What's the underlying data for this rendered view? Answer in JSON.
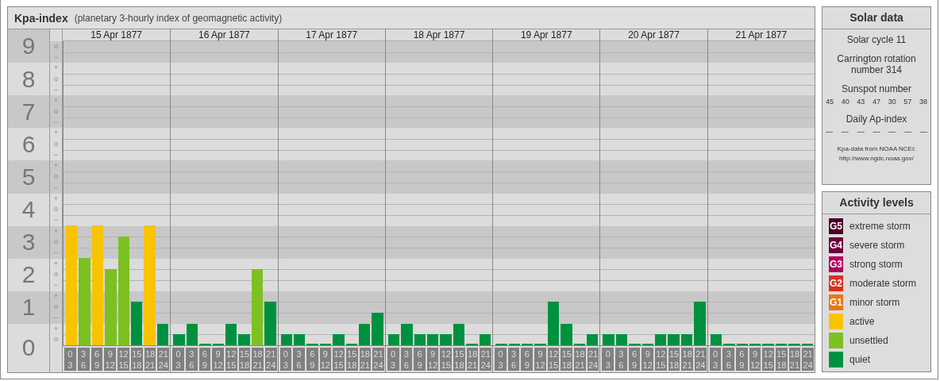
{
  "chart_panel": {
    "title": "Kpa-index",
    "subtitle": "(planetary 3-hourly index of geomagnetic activity)",
    "scale": [
      {
        "value": "9",
        "marks": [
          "o",
          "−"
        ]
      },
      {
        "value": "8",
        "marks": [
          "+",
          "o",
          "−"
        ]
      },
      {
        "value": "7",
        "marks": [
          "+",
          "o",
          "−"
        ]
      },
      {
        "value": "6",
        "marks": [
          "+",
          "o",
          "−"
        ]
      },
      {
        "value": "5",
        "marks": [
          "+",
          "o",
          "−"
        ]
      },
      {
        "value": "4",
        "marks": [
          "+",
          "o",
          "−"
        ]
      },
      {
        "value": "3",
        "marks": [
          "+",
          "o",
          "−"
        ]
      },
      {
        "value": "2",
        "marks": [
          "+",
          "o",
          "−"
        ]
      },
      {
        "value": "1",
        "marks": [
          "+",
          "o",
          "−"
        ]
      },
      {
        "value": "0",
        "marks": [
          "+",
          "o"
        ]
      }
    ],
    "days": [
      {
        "date": "15 Apr 1877",
        "slots": [
          {
            "from": "0",
            "to": "3",
            "level": 0.393,
            "color": "#f8c400"
          },
          {
            "from": "3",
            "to": "6",
            "level": 0.286,
            "color": "#7dc121"
          },
          {
            "from": "6",
            "to": "9",
            "level": 0.393,
            "color": "#f8c400"
          },
          {
            "from": "9",
            "to": "12",
            "level": 0.25,
            "color": "#7dc121"
          },
          {
            "from": "12",
            "to": "15",
            "level": 0.357,
            "color": "#7dc121"
          },
          {
            "from": "15",
            "to": "18",
            "level": 0.143,
            "color": "#009140"
          },
          {
            "from": "18",
            "to": "21",
            "level": 0.393,
            "color": "#f8c400"
          },
          {
            "from": "21",
            "to": "24",
            "level": 0.071,
            "color": "#009140"
          }
        ]
      },
      {
        "date": "16 Apr 1877",
        "slots": [
          {
            "from": "0",
            "to": "3",
            "level": 0.036,
            "color": "#009140"
          },
          {
            "from": "3",
            "to": "6",
            "level": 0.071,
            "color": "#009140"
          },
          {
            "from": "6",
            "to": "9",
            "level": 0,
            "color": "#009140"
          },
          {
            "from": "9",
            "to": "12",
            "level": 0,
            "color": "#009140"
          },
          {
            "from": "12",
            "to": "15",
            "level": 0.071,
            "color": "#009140"
          },
          {
            "from": "15",
            "to": "18",
            "level": 0.036,
            "color": "#009140"
          },
          {
            "from": "18",
            "to": "21",
            "level": 0.25,
            "color": "#7dc121"
          },
          {
            "from": "21",
            "to": "24",
            "level": 0.143,
            "color": "#009140"
          }
        ]
      },
      {
        "date": "17 Apr 1877",
        "slots": [
          {
            "from": "0",
            "to": "3",
            "level": 0.036,
            "color": "#009140"
          },
          {
            "from": "3",
            "to": "6",
            "level": 0.036,
            "color": "#009140"
          },
          {
            "from": "6",
            "to": "9",
            "level": 0,
            "color": "#009140"
          },
          {
            "from": "9",
            "to": "12",
            "level": 0,
            "color": "#009140"
          },
          {
            "from": "12",
            "to": "15",
            "level": 0.036,
            "color": "#009140"
          },
          {
            "from": "15",
            "to": "18",
            "level": 0,
            "color": "#009140"
          },
          {
            "from": "18",
            "to": "21",
            "level": 0.071,
            "color": "#009140"
          },
          {
            "from": "21",
            "to": "24",
            "level": 0.107,
            "color": "#009140"
          }
        ]
      },
      {
        "date": "18 Apr 1877",
        "slots": [
          {
            "from": "0",
            "to": "3",
            "level": 0.036,
            "color": "#009140"
          },
          {
            "from": "3",
            "to": "6",
            "level": 0.071,
            "color": "#009140"
          },
          {
            "from": "6",
            "to": "9",
            "level": 0.036,
            "color": "#009140"
          },
          {
            "from": "9",
            "to": "12",
            "level": 0.036,
            "color": "#009140"
          },
          {
            "from": "12",
            "to": "15",
            "level": 0.036,
            "color": "#009140"
          },
          {
            "from": "15",
            "to": "18",
            "level": 0.071,
            "color": "#009140"
          },
          {
            "from": "18",
            "to": "21",
            "level": 0,
            "color": "#009140"
          },
          {
            "from": "21",
            "to": "24",
            "level": 0.036,
            "color": "#009140"
          }
        ]
      },
      {
        "date": "19 Apr 1877",
        "slots": [
          {
            "from": "0",
            "to": "3",
            "level": 0,
            "color": "#009140"
          },
          {
            "from": "3",
            "to": "6",
            "level": 0,
            "color": "#009140"
          },
          {
            "from": "6",
            "to": "9",
            "level": 0,
            "color": "#009140"
          },
          {
            "from": "9",
            "to": "12",
            "level": 0,
            "color": "#009140"
          },
          {
            "from": "12",
            "to": "15",
            "level": 0.143,
            "color": "#009140"
          },
          {
            "from": "15",
            "to": "18",
            "level": 0.071,
            "color": "#009140"
          },
          {
            "from": "18",
            "to": "21",
            "level": 0,
            "color": "#009140"
          },
          {
            "from": "21",
            "to": "24",
            "level": 0.036,
            "color": "#009140"
          }
        ]
      },
      {
        "date": "20 Apr 1877",
        "slots": [
          {
            "from": "0",
            "to": "3",
            "level": 0.036,
            "color": "#009140"
          },
          {
            "from": "3",
            "to": "6",
            "level": 0.036,
            "color": "#009140"
          },
          {
            "from": "6",
            "to": "9",
            "level": 0,
            "color": "#009140"
          },
          {
            "from": "9",
            "to": "12",
            "level": 0,
            "color": "#009140"
          },
          {
            "from": "12",
            "to": "15",
            "level": 0.036,
            "color": "#009140"
          },
          {
            "from": "15",
            "to": "18",
            "level": 0.036,
            "color": "#009140"
          },
          {
            "from": "18",
            "to": "21",
            "level": 0.036,
            "color": "#009140"
          },
          {
            "from": "21",
            "to": "24",
            "level": 0.143,
            "color": "#009140"
          }
        ]
      },
      {
        "date": "21 Apr 1877",
        "slots": [
          {
            "from": "0",
            "to": "3",
            "level": 0.036,
            "color": "#009140"
          },
          {
            "from": "3",
            "to": "6",
            "level": 0,
            "color": "#009140"
          },
          {
            "from": "6",
            "to": "9",
            "level": 0,
            "color": "#009140"
          },
          {
            "from": "9",
            "to": "12",
            "level": 0,
            "color": "#009140"
          },
          {
            "from": "12",
            "to": "15",
            "level": 0,
            "color": "#009140"
          },
          {
            "from": "15",
            "to": "18",
            "level": 0,
            "color": "#009140"
          },
          {
            "from": "18",
            "to": "21",
            "level": 0,
            "color": "#009140"
          },
          {
            "from": "21",
            "to": "24",
            "level": 0,
            "color": "#009140"
          }
        ]
      }
    ]
  },
  "solar_data": {
    "title": "Solar data",
    "solar_cycle": "Solar cycle 11",
    "carrington_rotation": "Carrington rotation number 314",
    "sunspot_label": "Sunspot number",
    "sunspots": [
      "45",
      "40",
      "43",
      "47",
      "30",
      "57",
      "38"
    ],
    "ap_label": "Daily Ap-index",
    "ap_values": [
      "—",
      "—",
      "—",
      "—",
      "—",
      "—",
      "—"
    ],
    "source": "Kpa-data from NOAA NCEI:",
    "source_url": "http://www.ngdc.noaa.gov/"
  },
  "activity_levels": {
    "title": "Activity levels",
    "items": [
      {
        "badge": "G5",
        "label": "extreme storm",
        "color": "#4a0026"
      },
      {
        "badge": "G4",
        "label": "severe storm",
        "color": "#6e0040"
      },
      {
        "badge": "G3",
        "label": "strong storm",
        "color": "#b0005a"
      },
      {
        "badge": "G2",
        "label": "moderate storm",
        "color": "#d8321e"
      },
      {
        "badge": "G1",
        "label": "minor storm",
        "color": "#e67817"
      },
      {
        "label": "active",
        "color": "#f8c400"
      },
      {
        "label": "unsettled",
        "color": "#7dc121"
      },
      {
        "label": "quiet",
        "color": "#009140"
      }
    ]
  }
}
